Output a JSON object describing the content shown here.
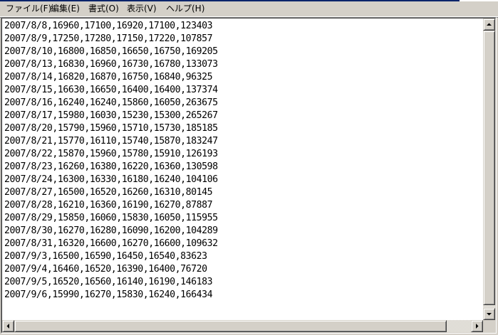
{
  "menu": [
    {
      "label": "ファイル(F)"
    },
    {
      "label": "編集(E)"
    },
    {
      "label": "書式(O)"
    },
    {
      "label": "表示(V)"
    },
    {
      "label": "ヘルプ(H)"
    }
  ],
  "document": {
    "lines": [
      "2007/8/8,16960,17100,16920,17100,123403",
      "2007/8/9,17250,17280,17150,17220,107857",
      "2007/8/10,16800,16850,16650,16750,169205",
      "2007/8/13,16830,16960,16730,16780,133073",
      "2007/8/14,16820,16870,16750,16840,96325",
      "2007/8/15,16630,16650,16400,16400,137374",
      "2007/8/16,16240,16240,15860,16050,263675",
      "2007/8/17,15980,16030,15230,15300,265267",
      "2007/8/20,15790,15960,15710,15730,185185",
      "2007/8/21,15770,16110,15740,15870,183247",
      "2007/8/22,15870,15960,15780,15910,126193",
      "2007/8/23,16260,16380,16220,16360,130598",
      "2007/8/24,16300,16330,16180,16240,104106",
      "2007/8/27,16500,16520,16260,16310,80145",
      "2007/8/28,16210,16360,16190,16270,87887",
      "2007/8/29,15850,16060,15830,16050,115955",
      "2007/8/30,16270,16280,16090,16200,104289",
      "2007/8/31,16320,16600,16270,16600,109632",
      "2007/9/3,16500,16590,16450,16540,83623",
      "2007/9/4,16460,16520,16390,16400,76720",
      "2007/9/5,16520,16560,16140,16190,146183",
      "2007/9/6,15990,16270,15830,16240,166434"
    ]
  },
  "scrollbars": {
    "vertical": {
      "up_icon": "arrow-up-icon",
      "down_icon": "arrow-down-icon",
      "position": 0.0
    },
    "horizontal": {
      "left_icon": "arrow-left-icon",
      "right_icon": "arrow-right-icon",
      "position": 0.0
    }
  },
  "colors": {
    "chrome": "#d4d0c8",
    "title_bar": "#0a246a",
    "text_background": "#ffffff",
    "text": "#000000"
  }
}
